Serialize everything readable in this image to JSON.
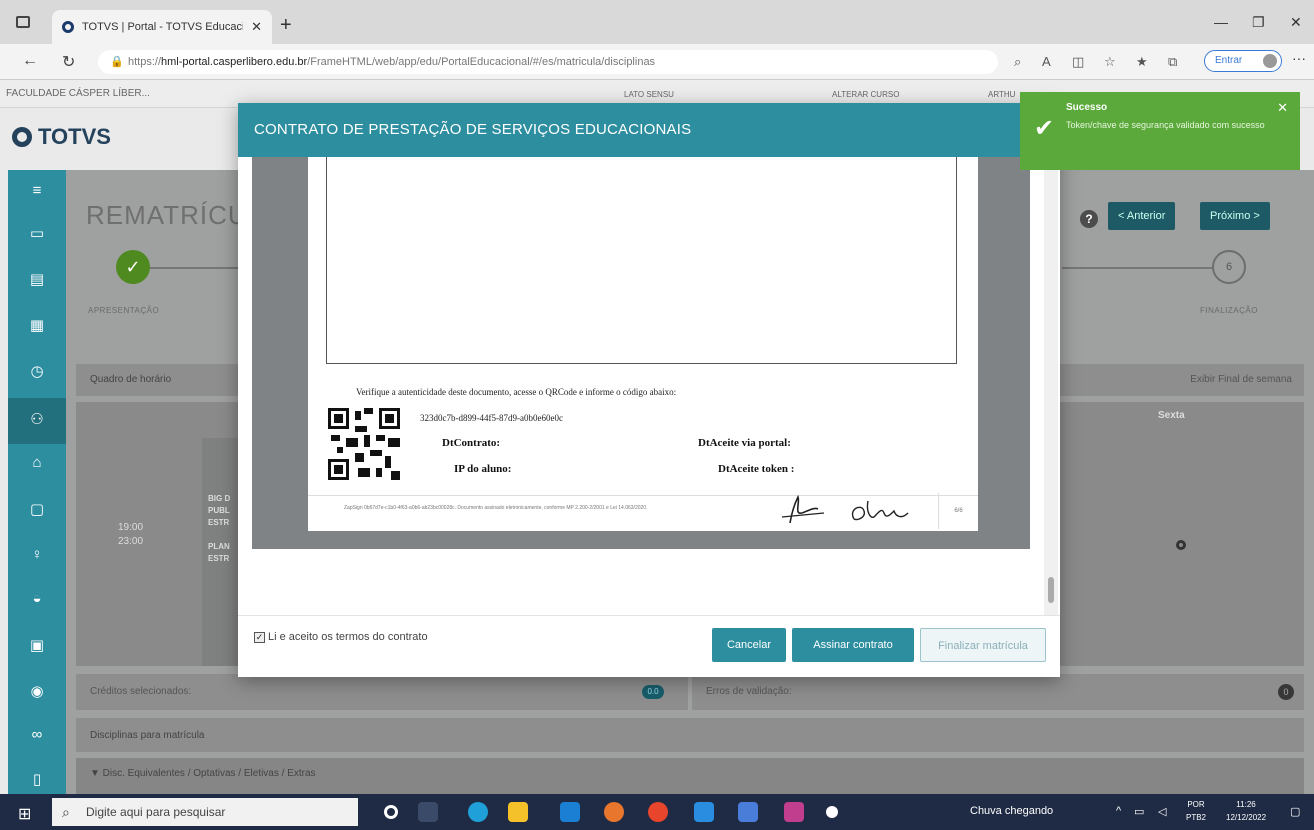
{
  "browser": {
    "tab_title": "TOTVS | Portal - TOTVS Educacio",
    "url_prefix": "https://",
    "url_host": "hml-portal.casperlibero.edu.br",
    "url_path": "/FrameHTML/web/app/edu/PortalEducacional/#/es/matricula/disciplinas",
    "signin_label": "Entrar"
  },
  "portal": {
    "institution": "FACULDADE CÁSPER LÍBER...",
    "nav": [
      "LATO SENSU",
      "ALTERAR CURSO",
      "ARTHU"
    ],
    "logo_text": "TOTVS",
    "page_title": "REMATRÍCU",
    "prev_button": "< Anterior",
    "next_button": "Próximo >",
    "step1_label": "APRESENTAÇÃO",
    "step6_label": "FINALIZAÇÃO",
    "step6_number": "6",
    "schedule_title": "Quadro de horário",
    "weekend_label": "Exibir Final de semana",
    "friday_label": "Sexta",
    "time_start": "19:00",
    "time_end": "23:00",
    "cell_lines": [
      "BIG D",
      "PUBL",
      "ESTR",
      "PLAN",
      "ESTR"
    ],
    "credits_label": "Créditos selecionados:",
    "credits_value": "0.0",
    "errors_label": "Erros de validação:",
    "errors_value": "0",
    "disciplines_title": "Disciplinas para matrícula",
    "disciplines_group": "▼ Disc. Equivalentes / Optativas / Eletivas / Extras"
  },
  "modal": {
    "title": "CONTRATO DE PRESTAÇÃO DE SERVIÇOS EDUCACIONAIS",
    "verify_text": "Verifique a autenticidade deste documento, acesse o QRCode e informe o código abaixo:",
    "code": "323d0c7b-d899-44f5-87d9-a0b0e60e0c",
    "field_contract": "DtContrato:",
    "field_ip": "IP do aluno:",
    "field_portal": "DtAceite via portal:",
    "field_token": "DtAceite token :",
    "footer_text": "ZapSign 0b67d7e-c1b0-4f63-a0b6-ab23bc00028c. Documento assinado eletronicamente, conforme MP 2.200-2/2001 e Lei 14.063/2020.",
    "page_number": "6/6",
    "accept_label": "Li e aceito os termos do contrato",
    "accept_checked": "✓",
    "cancel_label": "Cancelar",
    "sign_label": "Assinar contrato",
    "finish_label": "Finalizar matrícula"
  },
  "toast": {
    "title": "Sucesso",
    "message": "Token/chave de segurança validado com sucesso",
    "color": "#5aa93a"
  },
  "taskbar": {
    "search_placeholder": "Digite aqui para pesquisar",
    "weather": "Chuva chegando",
    "lang_top": "POR",
    "lang_bottom": "PTB2",
    "time": "11:26",
    "date": "12/12/2022"
  },
  "colors": {
    "accent": "#2d8ea0",
    "sidebar": "#2d8ea0",
    "success": "#5aa93a",
    "taskbar": "#1f2a44"
  }
}
